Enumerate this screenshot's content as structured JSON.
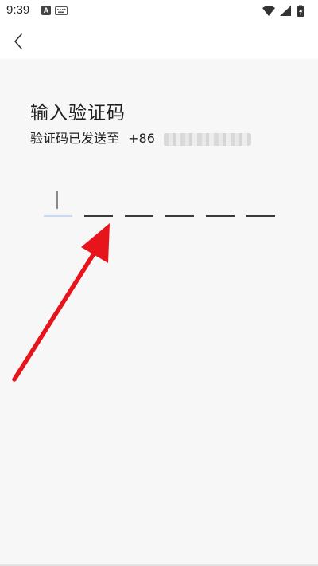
{
  "status_bar": {
    "time": "9:39",
    "notification_badge": "A",
    "icons": [
      "keyboard-icon",
      "wifi-icon",
      "cellular-signal-icon",
      "battery-charging-icon"
    ]
  },
  "header": {
    "back_icon": "chevron-left-icon"
  },
  "page": {
    "title": "输入验证码",
    "subtitle_prefix": "验证码已发送至",
    "country_code": "+86"
  },
  "code_input": {
    "digits": [
      "",
      "",
      "",
      "",
      "",
      ""
    ],
    "active_index": 0
  },
  "annotation": {
    "arrow_color": "#e8141c"
  },
  "colors": {
    "background": "#f7f7f7",
    "header_background": "#ffffff",
    "active_underline": "#c9d9f4",
    "inactive_underline": "#3a3a3a"
  }
}
